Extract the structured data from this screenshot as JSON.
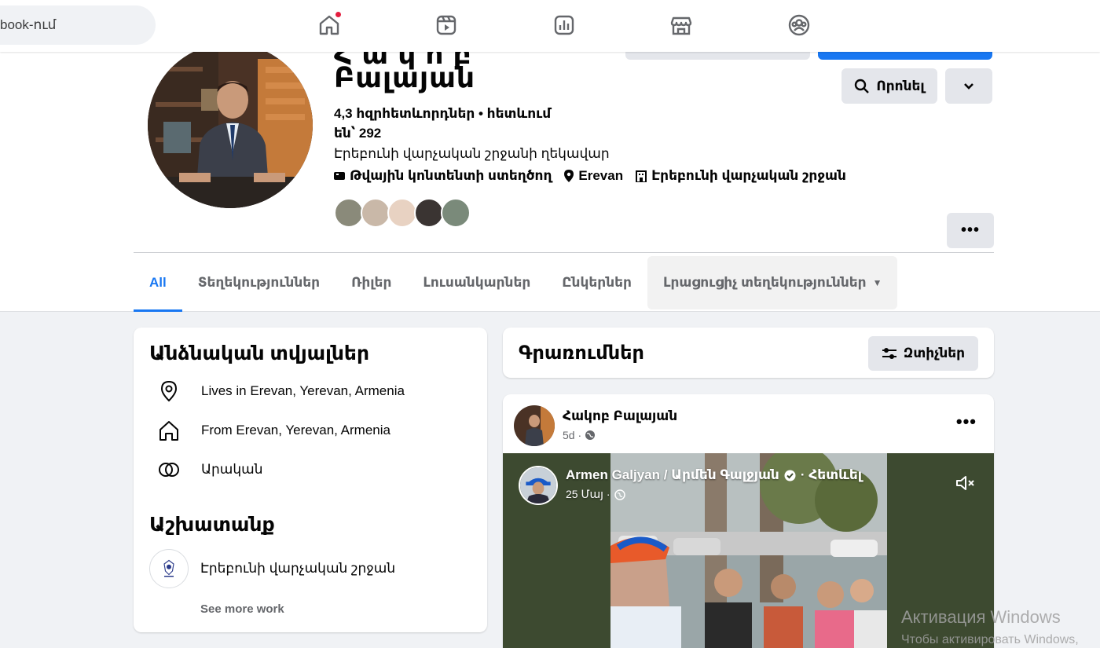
{
  "topnav": {
    "search_text": "book-ում",
    "icons": [
      "home-icon",
      "reels-icon",
      "dashboard-icon",
      "marketplace-icon",
      "groups-icon"
    ]
  },
  "profile": {
    "name": "Բալայան",
    "name_partial_above": "Հ ա կ ո բ",
    "followers_line": "4,3 հզրհետևորդներ • հետևում են՝ 292",
    "bio": "Էրեբունի վարչական շրջանի ղեկավար",
    "meta": {
      "category": "Թվային կոնտենտի ստեղծող",
      "location": "Erevan",
      "workplace": "Էրեբունի վարչական շրջան"
    },
    "search_button": "Որոնել"
  },
  "tabs": {
    "items": [
      {
        "label": "All"
      },
      {
        "label": "Տեղեկություններ"
      },
      {
        "label": "Ռիլեր"
      },
      {
        "label": "Լուսանկարներ"
      },
      {
        "label": "Ընկերներ"
      },
      {
        "label": "Լրացուցիչ տեղեկություններ"
      }
    ],
    "more_label": "•••"
  },
  "intro": {
    "title": "Անձնական տվյալներ",
    "lives_in": "Lives in Erevan, Yerevan, Armenia",
    "from": "From Erevan, Yerevan, Armenia",
    "relationship": "Արական",
    "work_title": "Աշխատանք",
    "work_place": "Էրեբունի վարչական շրջան",
    "see_more": "See more work"
  },
  "posts": {
    "title": "Գրառումներ",
    "filters": "Զտիչներ",
    "post": {
      "author": "Հակոբ Բալայան",
      "time": "5d ·",
      "more": "•••",
      "shared": {
        "author": "Armen Galjyan / Արմեն Գալջյան",
        "follow": "· Հետևել",
        "date": "25 Մայ ·"
      }
    }
  },
  "watermark": {
    "line1": "Активация Windows",
    "line2": "Чтобы активировать Windows,"
  },
  "colors": {
    "accent": "#1877f2",
    "page_bg": "#f0f2f5",
    "notif": "#e41e3f"
  }
}
